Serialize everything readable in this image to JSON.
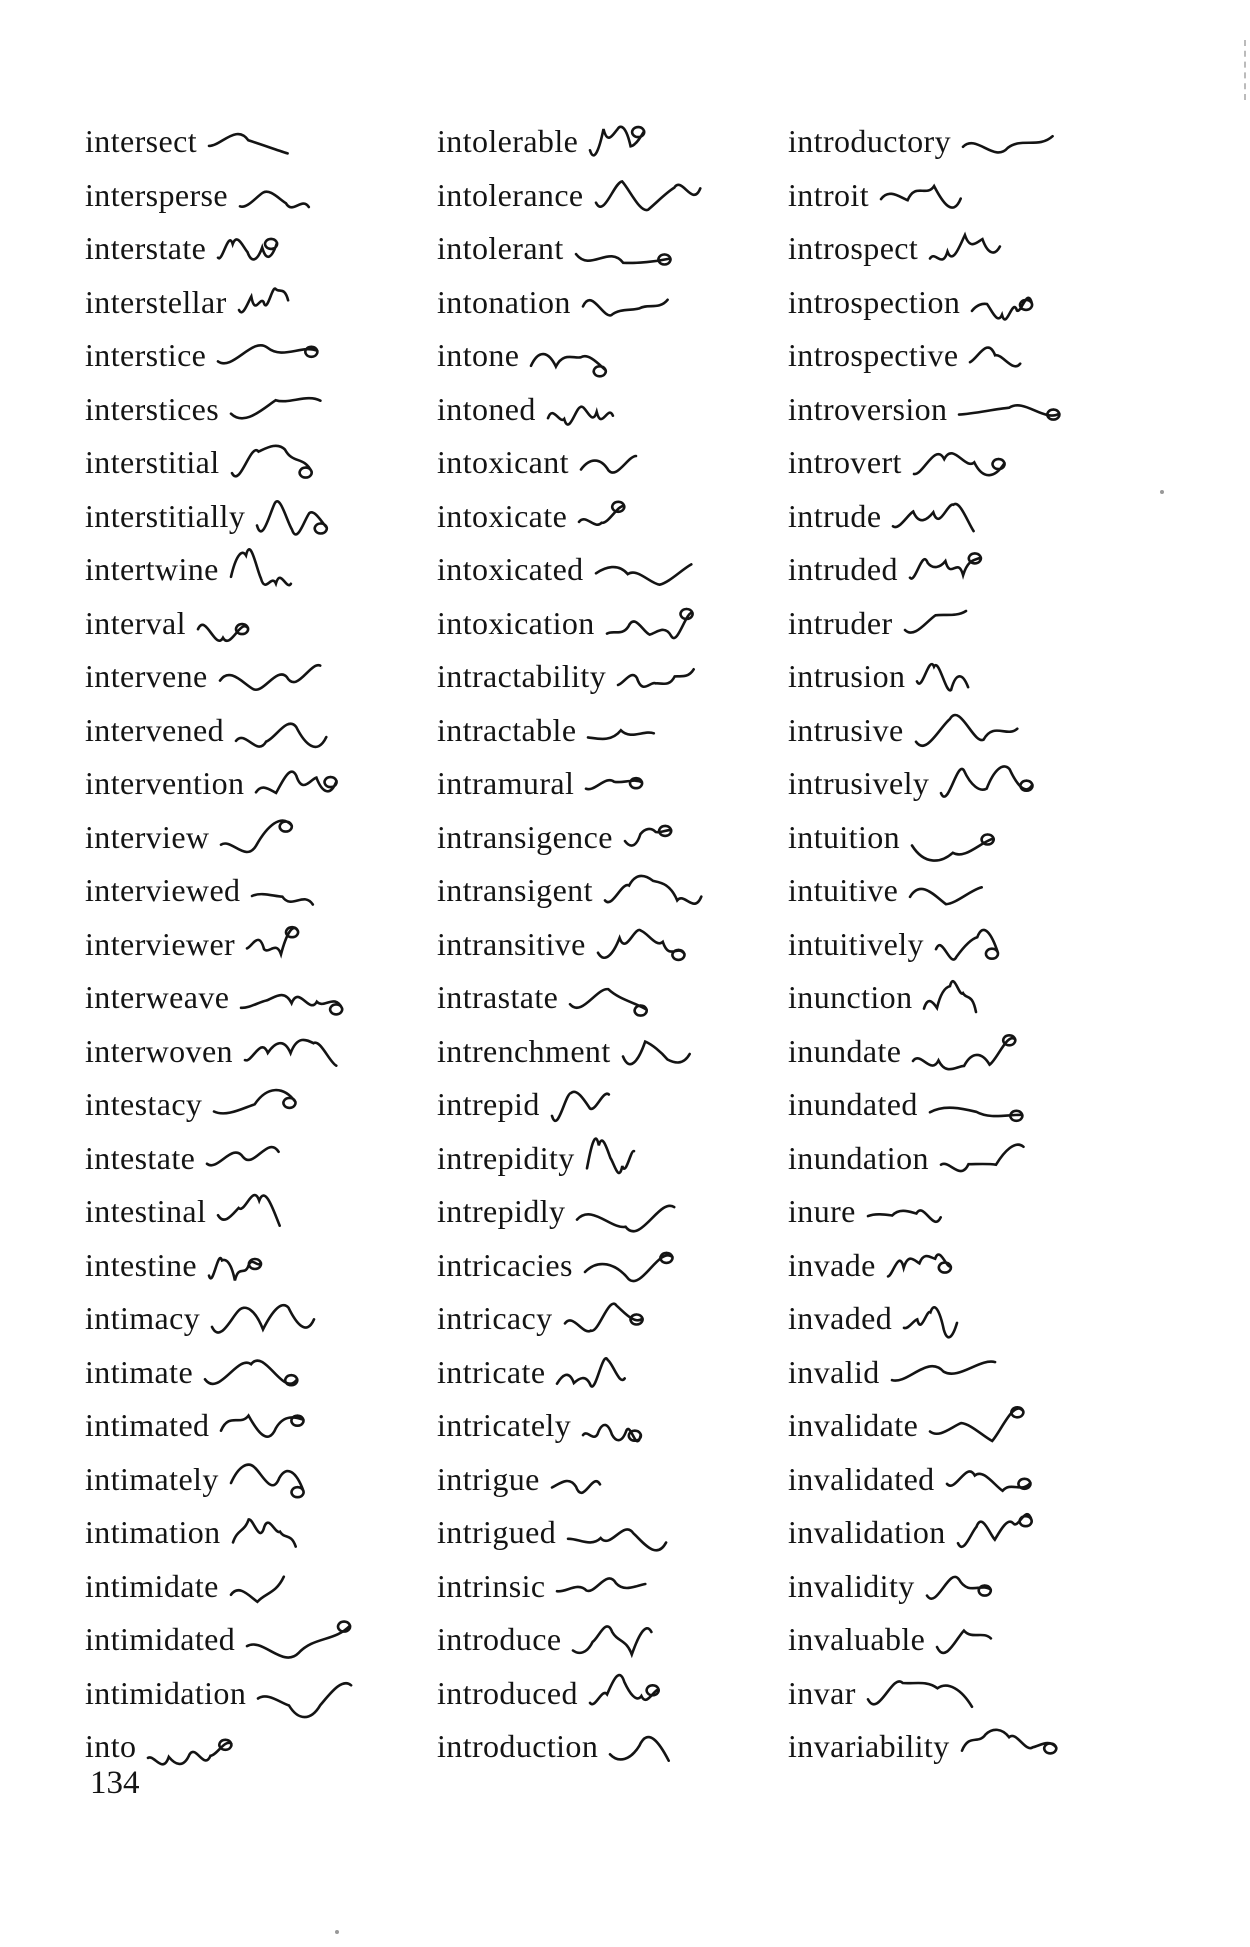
{
  "columns": {
    "left": [
      "intersect",
      "intersperse",
      "interstate",
      "interstellar",
      "interstice",
      "interstices",
      "interstitial",
      "interstitially",
      "intertwine",
      "interval",
      "intervene",
      "intervened",
      "intervention",
      "interview",
      "interviewed",
      "interviewer",
      "interweave",
      "interwoven",
      "intestacy",
      "intestate",
      "intestinal",
      "intestine",
      "intimacy",
      "intimate",
      "intimated",
      "intimately",
      "intimation",
      "intimidate",
      "intimidated",
      "intimidation",
      "into"
    ],
    "middle": [
      "intolerable",
      "intolerance",
      "intolerant",
      "intonation",
      "intone",
      "intoned",
      "intoxicant",
      "intoxicate",
      "intoxicated",
      "intoxication",
      "intractability",
      "intractable",
      "intramural",
      "intransigence",
      "intransigent",
      "intransitive",
      "intrastate",
      "intrenchment",
      "intrepid",
      "intrepidity",
      "intrepidly",
      "intricacies",
      "intricacy",
      "intricate",
      "intricately",
      "intrigue",
      "intrigued",
      "intrinsic",
      "introduce",
      "introduced",
      "introduction"
    ],
    "right": [
      "introductory",
      "introit",
      "introspect",
      "introspection",
      "introspective",
      "introversion",
      "introvert",
      "intrude",
      "intruded",
      "intruder",
      "intrusion",
      "intrusive",
      "intrusively",
      "intuition",
      "intuitive",
      "intuitively",
      "inunction",
      "inundate",
      "inundated",
      "inundation",
      "inure",
      "invade",
      "invaded",
      "invalid",
      "invalidate",
      "invalidated",
      "invalidation",
      "invalidity",
      "invaluable",
      "invar",
      "invariability"
    ]
  },
  "page_number": "134",
  "colors": {
    "ink": "#141414",
    "paper": "#ffffff"
  }
}
